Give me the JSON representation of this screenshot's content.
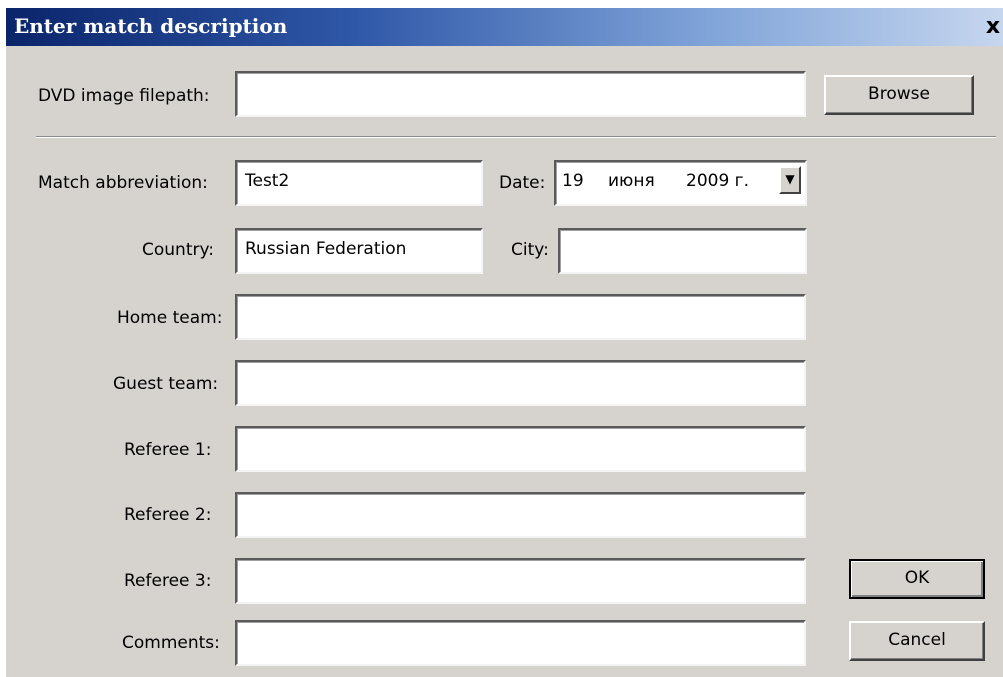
{
  "window": {
    "title": "Enter match description",
    "close_glyph": "x"
  },
  "dvd": {
    "label": "DVD image filepath:",
    "value": "",
    "browse_label": "Browse"
  },
  "match": {
    "abbrev_label": "Match abbreviation:",
    "abbrev_value": "Test2",
    "date_label": "Date:",
    "date_day": "19",
    "date_month": "июня",
    "date_year": "2009 г.",
    "country_label": "Country:",
    "country_value": "Russian Federation",
    "city_label": "City:",
    "city_value": "",
    "home_label": "Home team:",
    "home_value": "",
    "guest_label": "Guest team:",
    "guest_value": "",
    "ref1_label": "Referee 1:",
    "ref1_value": "",
    "ref2_label": "Referee 2:",
    "ref2_value": "",
    "ref3_label": "Referee 3:",
    "ref3_value": "",
    "comments_label": "Comments:",
    "comments_value": ""
  },
  "buttons": {
    "ok_label": "OK",
    "cancel_label": "Cancel"
  },
  "icons": {
    "dropdown": "chevron-down-icon",
    "close": "close-icon"
  }
}
